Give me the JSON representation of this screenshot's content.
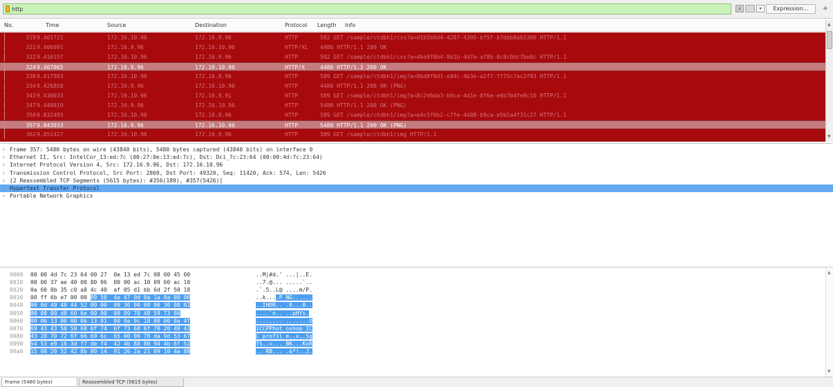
{
  "filter": {
    "value": "http",
    "expression_label": "Expression...",
    "add_label": "+",
    "clear_label": "×",
    "dropdown_label": "▾"
  },
  "packet_list": {
    "columns": [
      "No.",
      "Time",
      "Source",
      "Destination",
      "Protocol",
      "Length",
      "Info"
    ],
    "rows": [
      {
        "no": "319",
        "time": "9.401721",
        "source": "172.16.10.96",
        "destination": "172.16.9.96",
        "protocol": "HTTP",
        "length": "",
        "info": "582 GET /sample/ctdbh1/css?a=d1b5b0d4-4287-4395-bf5f-b7dbb8ab5300 HTTP/1.1",
        "style": "red"
      },
      {
        "no": "321",
        "time": "9.406091",
        "source": "172.16.9.96",
        "destination": "172.16.10.96",
        "protocol": "HTTP/XL",
        "length": "",
        "info": "4486 HTTP/1.1 200 OK",
        "style": "red"
      },
      {
        "no": "322",
        "time": "9.410157",
        "source": "172.16.10.96",
        "destination": "172.16.9.96",
        "protocol": "HTTP",
        "length": "",
        "info": "582 GET /sample/ctdbh1/css?a=4ba9f0b4-8b1b-4d7a-a78b-0c8c0dc7be8c HTTP/1.1",
        "style": "red"
      },
      {
        "no": "324",
        "time": "9.407065",
        "source": "172.16.9.96",
        "destination": "172.16.10.96",
        "protocol": "HTTP/X",
        "length": "",
        "info": "4486 HTTP/1.1 200 OK",
        "style": "hl"
      },
      {
        "no": "330",
        "time": "9.417503",
        "source": "172.16.10.96",
        "destination": "172.16.9.96",
        "protocol": "HTTP",
        "length": "",
        "info": "589 GET /sample/ctdbh1/img?a=0bd8f9d1-e84c-4b3e-a2f7-ff75c7ac2f93 HTTP/1.1",
        "style": "red"
      },
      {
        "no": "334",
        "time": "9.426858",
        "source": "172.16.9.96",
        "destination": "172.16.10.96",
        "protocol": "HTTP",
        "length": "",
        "info": "4480 HTTP/1.1 200 OK  (PNG)",
        "style": "red"
      },
      {
        "no": "343",
        "time": "9.430033",
        "source": "172.16.10.96",
        "destination": "172.16.9.91",
        "protocol": "HTTP",
        "length": "",
        "info": "589 GET /sample/ctdbh1/img?a=8c2d6da3-b0ca-4d1e-8f6e-e6b7b4fe8c10 HTTP/1.1",
        "style": "red"
      },
      {
        "no": "347",
        "time": "9.440019",
        "source": "172.16.9.96",
        "destination": "172.16.10.96",
        "protocol": "HTTP",
        "length": "",
        "info": "5480 HTTP/1.1 200 OK  (PNG)",
        "style": "red"
      },
      {
        "no": "350",
        "time": "9.832493",
        "source": "172.16.10.96",
        "destination": "172.16.9.96",
        "protocol": "HTTP",
        "length": "",
        "info": "589 GET /sample/ctdbh1/img?a=e4c5f6b2-c7fe-4488-b9ca-e5b5a4f31c27 HTTP/1.1",
        "style": "red"
      },
      {
        "no": "357",
        "time": "9.843033",
        "source": "172.16.9.96",
        "destination": "172.16.10.96",
        "protocol": "HTTP",
        "length": "",
        "info": "5480 HTTP/1.1 200 OK  (PNG)",
        "style": "hl"
      },
      {
        "no": "362",
        "time": "9.851427",
        "source": "172.16.10.96",
        "destination": "172.16.9.96",
        "protocol": "HTTP",
        "length": "",
        "info": "589 GET /sample/ctdbh1/img HTTP/1.1",
        "style": "red"
      }
    ]
  },
  "details": [
    {
      "text": "Frame 357: 5480 bytes on wire (43840 bits), 5480 bytes captured (43840 bits) on interface 0",
      "selected": false
    },
    {
      "text": "Ethernet II, Src: IntelCor_13:ed:7c (00:27:0e:13:ed:7c), Dst: Dci_7c:23:64 (00:00:4d:7c:23:64)",
      "selected": false
    },
    {
      "text": "Internet Protocol Version 4, Src: 172.16.9.96, Dst: 172.16.10.96",
      "selected": false
    },
    {
      "text": "Transmission Control Protocol, Src Port: 2869, Dst Port: 49320, Seq: 11420, Ack: 574, Len: 5426",
      "selected": false
    },
    {
      "text": "[2 Reassembled TCP Segments (5615 bytes): #356(189), #357(5426)]",
      "selected": false
    },
    {
      "text": "Hypertext Transfer Protocol",
      "selected": true
    },
    {
      "text": "Portable Network Graphics",
      "selected": false
    }
  ],
  "bytes": [
    {
      "offset": "0000",
      "hex_a": "00 00 4d 7c 23 64 00 27  0e 13 ed 7c 08 00 45 00",
      "hex_b": "",
      "ascii_a": "..M|#d.' ...|..E.",
      "ascii_b": ""
    },
    {
      "offset": "0010",
      "hex_a": "00 00 37 ae 40 00 80 06  00 00 ac 10 09 60 ac 10",
      "hex_b": "",
      "ascii_a": "..7.@... .....`..",
      "ascii_b": ""
    },
    {
      "offset": "0020",
      "hex_a": "0a 60 0b 35 c0 a8 4c 40  af 05 d1 bb 6d 2f 50 18",
      "hex_b": "",
      "ascii_a": ".`.5..L@ ....m/P.",
      "ascii_b": ""
    },
    {
      "offset": "0030",
      "hex_a": "00 ff 6b e7 00 00 ",
      "hex_b": "89 50  4e 47 0d 0a 1a 0a 00 00",
      "ascii_a": "..k...",
      "ascii_b": ".P NG......"
    },
    {
      "offset": "0040",
      "hex_a": "",
      "hex_b": "00 0d 49 48 44 52 00 00  00 30 00 00 00 30 08 02",
      "ascii_a": "",
      "ascii_b": "..IHDR.. .0...0.."
    },
    {
      "offset": "0050",
      "hex_a": "",
      "hex_b": "00 00 00 d8 60 6e 00 00  00 09 70 48 59 73 00",
      "ascii_a": "",
      "ascii_b": "....`n.. ..pHYs."
    },
    {
      "offset": "0060",
      "hex_a": "",
      "hex_b": "00 0b 13 00 00 0b 13 01  00 9a 9c 18 00 00 0a 4f",
      "ascii_a": "",
      "ascii_b": "........ .......O"
    },
    {
      "offset": "0070",
      "hex_a": "",
      "hex_b": "69 43 43 50 50 68 6f 74  6f 73 68 6f 70 20 49 43",
      "ascii_a": "",
      "ascii_b": "iCCPPhot oshop IC"
    },
    {
      "offset": "0080",
      "hex_a": "",
      "hex_b": "43 20 70 72 6f 66 69 6c  65 00 00 78 da 9d 53 67",
      "ascii_a": "",
      "ascii_b": "C profil e..x..Sg"
    },
    {
      "offset": "0090",
      "hex_a": "",
      "hex_b": "54 53 e9 16 3d f7 de f4  42 4b 88 80 94 4b 6f 52",
      "ascii_a": "",
      "ascii_b": "TS..=... BK...KoR"
    },
    {
      "offset": "00a0",
      "hex_a": "",
      "hex_b": "15 08 20 52 42 8b 80 14  91 26 2a 21 09 10 4a 88",
      "ascii_a": "",
      "ascii_b": ".. RB... .&*!..J."
    }
  ],
  "tabs": {
    "frame": "Frame (5480 bytes)",
    "reassembled": "Reassembled TCP (5615 bytes)"
  }
}
